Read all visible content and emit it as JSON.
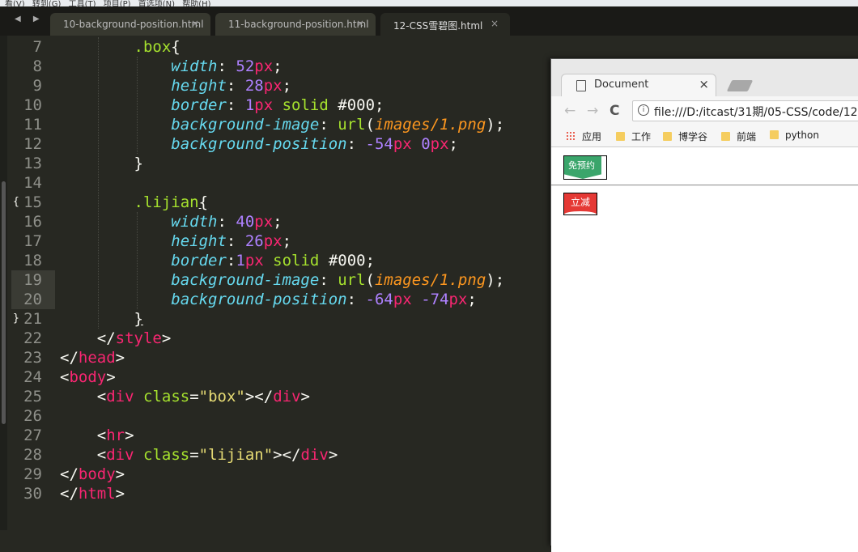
{
  "editor": {
    "menu": [
      "看(V)",
      "转到(G)",
      "工具(T)",
      "项目(P)",
      "首选项(N)",
      "帮助(H)"
    ],
    "nav_arrows": "◀ ▶",
    "tabs": [
      {
        "label": "10-background-position.html",
        "close": "×"
      },
      {
        "label": "11-background-position.html",
        "close": "×"
      },
      {
        "label": "12-CSS雪碧图.html",
        "close": "×"
      }
    ],
    "active_tab": 2,
    "fold_open": "{",
    "fold_close": "}",
    "line_numbers": [
      "7",
      "8",
      "9",
      "10",
      "11",
      "12",
      "13",
      "14",
      "15",
      "16",
      "17",
      "18",
      "19",
      "20",
      "21",
      "22",
      "23",
      "24",
      "25",
      "26",
      "27",
      "28",
      "29",
      "30"
    ],
    "code_text": {
      "box_sel": ".box",
      "lijian_sel": ".lijian",
      "width": "width",
      "height": "height",
      "border": "border",
      "bg_image": "background-image",
      "bg_position": "background-position",
      "url_fn": "url",
      "url_path": "images/1.png",
      "solid": "solid",
      "color_000": "#000",
      "v52": "52",
      "v28": "28",
      "v40": "40",
      "v26": "26",
      "v1": "1",
      "vm54": "-54",
      "v0": "0",
      "vm64": "-64",
      "vm74": "-74",
      "px": "px",
      "style": "style",
      "head": "head",
      "body": "body",
      "html": "html",
      "div": "div",
      "hr": "hr",
      "class": "class",
      "box_str": "\"box\"",
      "lijian_str": "\"lijian\""
    }
  },
  "browser": {
    "tab_title": "Document",
    "tab_close": "×",
    "back": "←",
    "forward": "→",
    "reload": "C",
    "address": "file:///D:/itcast/31期/05-CSS/code/12-",
    "bookmarks": [
      "应用",
      "工作",
      "博学谷",
      "前端",
      "python"
    ],
    "page": {
      "box_label": "免预约",
      "lijian_label": "立减"
    }
  }
}
